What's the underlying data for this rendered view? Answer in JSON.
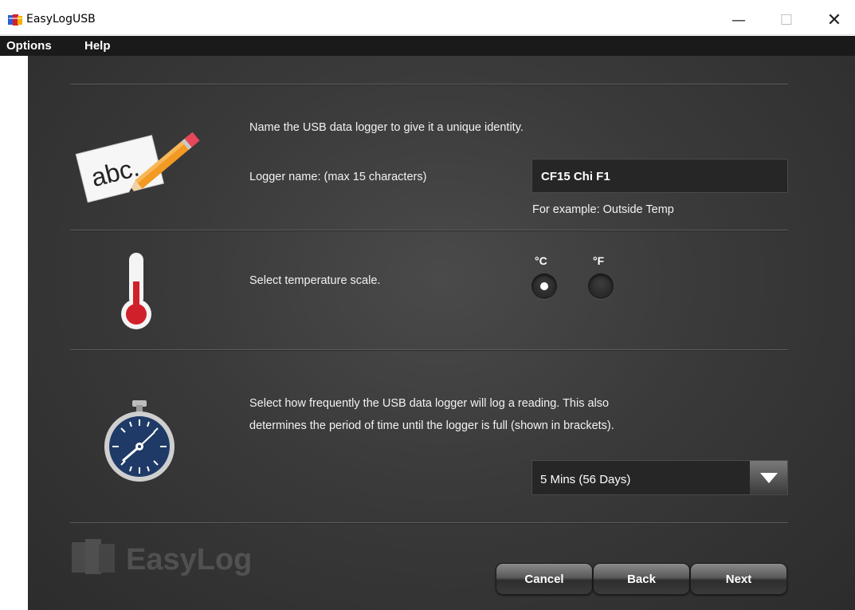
{
  "window": {
    "title": "EasyLogUSB",
    "minimize_glyph": "—",
    "maximize_glyph": "☐",
    "close_glyph": "✕"
  },
  "menu": {
    "items": [
      {
        "label": "Options"
      },
      {
        "label": "Help"
      }
    ]
  },
  "name_section": {
    "heading": "Name the USB data logger to give it a unique identity.",
    "field_label": "Logger name: (max 15 characters)",
    "field_value": "CF15 Chi F1",
    "hint": "For example: Outside Temp",
    "icon": "abc-pencil-icon",
    "icon_text": "abc."
  },
  "temperature_section": {
    "label": "Select temperature scale.",
    "options": [
      {
        "label": "°C",
        "selected": true
      },
      {
        "label": "°F",
        "selected": false
      }
    ],
    "icon": "thermometer-icon"
  },
  "interval_section": {
    "line1": "Select how frequently the USB data logger will log a reading. This also",
    "line2": "determines the period of time until the logger is full (shown in brackets).",
    "selected_value": "5 Mins (56 Days)",
    "icon": "stopwatch-icon"
  },
  "buttons": {
    "cancel": "Cancel",
    "back": "Back",
    "next": "Next"
  },
  "logo": {
    "text": "EasyLog"
  },
  "colors": {
    "background": "#3a3a3a",
    "thermometer_red": "#d0202a",
    "stopwatch_face": "#1f3a66",
    "pencil_orange": "#f08a1c"
  }
}
